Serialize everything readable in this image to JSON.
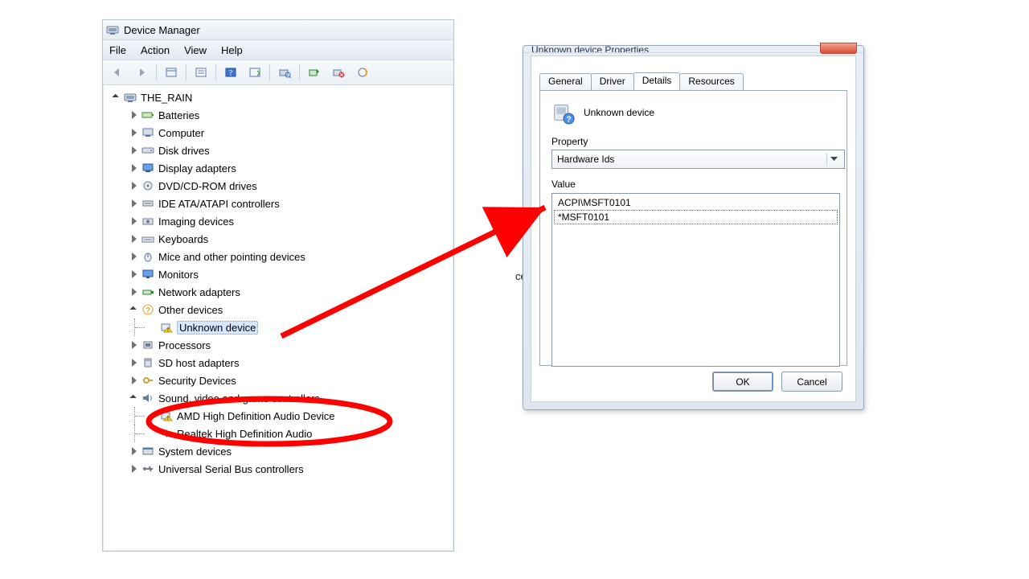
{
  "device_manager": {
    "title": "Device Manager",
    "menu": {
      "file": "File",
      "action": "Action",
      "view": "View",
      "help": "Help"
    },
    "root": "THE_RAIN",
    "categories": [
      {
        "label": "Batteries",
        "state": "collapsed"
      },
      {
        "label": "Computer",
        "state": "collapsed"
      },
      {
        "label": "Disk drives",
        "state": "collapsed"
      },
      {
        "label": "Display adapters",
        "state": "collapsed"
      },
      {
        "label": "DVD/CD-ROM drives",
        "state": "collapsed"
      },
      {
        "label": "IDE ATA/ATAPI controllers",
        "state": "collapsed"
      },
      {
        "label": "Imaging devices",
        "state": "collapsed"
      },
      {
        "label": "Keyboards",
        "state": "collapsed"
      },
      {
        "label": "Mice and other pointing devices",
        "state": "collapsed"
      },
      {
        "label": "Monitors",
        "state": "collapsed"
      },
      {
        "label": "Network adapters",
        "state": "collapsed"
      },
      {
        "label": "Other devices",
        "state": "expanded",
        "children": [
          {
            "label": "Unknown device",
            "warn": true,
            "selected": true
          }
        ]
      },
      {
        "label": "Processors",
        "state": "collapsed"
      },
      {
        "label": "SD host adapters",
        "state": "collapsed"
      },
      {
        "label": "Security Devices",
        "state": "collapsed"
      },
      {
        "label": "Sound, video and game controllers",
        "state": "expanded",
        "children": [
          {
            "label": "AMD High Definition Audio Device",
            "warn": true
          },
          {
            "label": "Realtek High Definition Audio"
          }
        ]
      },
      {
        "label": "System devices",
        "state": "collapsed"
      },
      {
        "label": "Universal Serial Bus controllers",
        "state": "collapsed"
      }
    ]
  },
  "properties": {
    "title": "Unknown device Properties",
    "tabs": {
      "general": "General",
      "driver": "Driver",
      "details": "Details",
      "resources": "Resources"
    },
    "active_tab": "details",
    "device_name": "Unknown device",
    "property_label": "Property",
    "property_value": "Hardware Ids",
    "value_label": "Value",
    "values": [
      "ACPI\\MSFT0101",
      "*MSFT0101"
    ],
    "ok": "OK",
    "cancel": "Cancel"
  },
  "annotations": {
    "color": "#ff0000"
  },
  "truncated_text": "ce"
}
